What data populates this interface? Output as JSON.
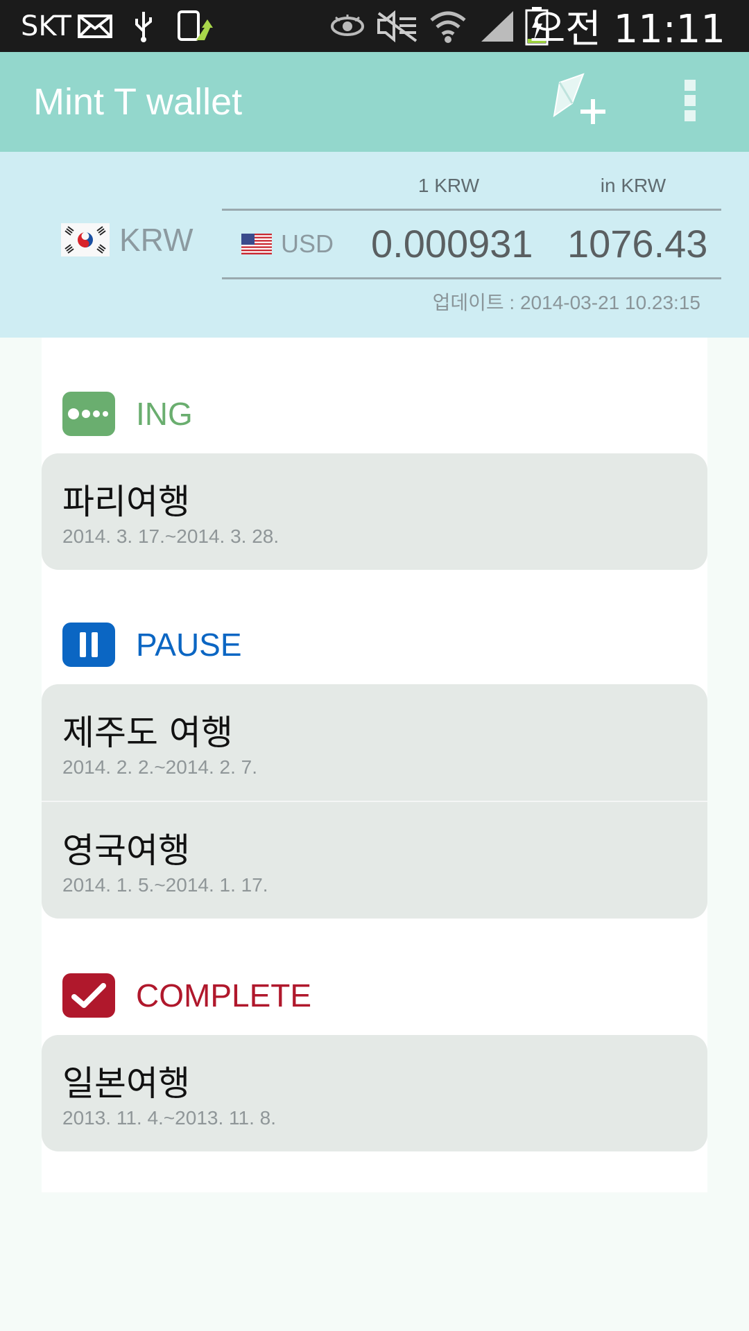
{
  "status_bar": {
    "carrier": "SKT",
    "time": "오전 11:11",
    "icons": [
      "mail-icon",
      "usb-icon",
      "upload-icon",
      "eye-icon",
      "mute-icon",
      "wifi-icon",
      "signal-icon",
      "battery-charging-icon"
    ]
  },
  "app_bar": {
    "title": "Mint T wallet",
    "actions": [
      "add-trip-icon",
      "overflow-menu-icon"
    ],
    "color": "#93d7cc"
  },
  "exchange": {
    "base_currency": "KRW",
    "header_rate": "1 KRW",
    "header_converted": "in KRW",
    "target_currency": "USD",
    "rate": "0.000931",
    "converted": "1076.43",
    "updated": "업데이트 : 2014-03-21 10.23:15"
  },
  "sections": {
    "ing": {
      "title": "ING",
      "color": "#6aae6f",
      "trips": [
        {
          "name": "파리여행",
          "dates": "2014. 3. 17.~2014. 3. 28."
        }
      ]
    },
    "pause": {
      "title": "PAUSE",
      "color": "#0b66c3",
      "trips": [
        {
          "name": "제주도 여행",
          "dates": "2014. 2. 2.~2014. 2. 7."
        },
        {
          "name": "영국여행",
          "dates": "2014. 1. 5.~2014. 1. 17."
        }
      ]
    },
    "complete": {
      "title": "COMPLETE",
      "color": "#b0182c",
      "trips": [
        {
          "name": "일본여행",
          "dates": "2013. 11. 4.~2013. 11. 8."
        }
      ]
    }
  }
}
